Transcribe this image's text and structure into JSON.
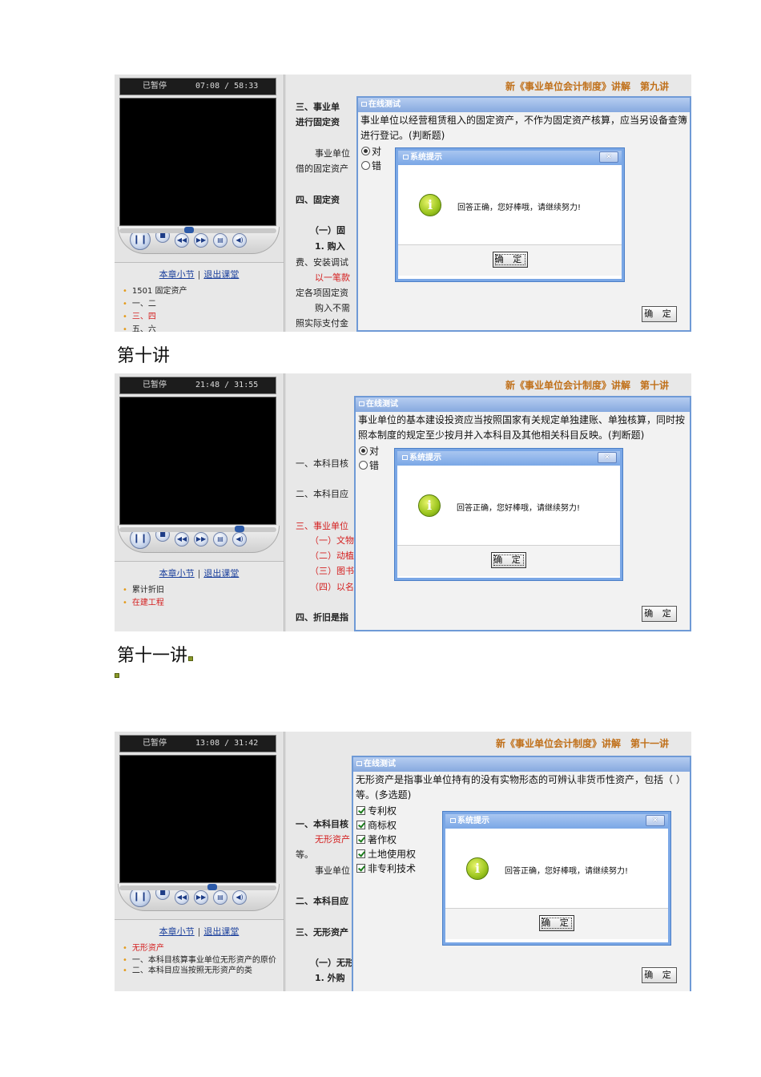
{
  "headings": {
    "lecture10": "第十讲",
    "lecture11": "第十一讲"
  },
  "common": {
    "chapter_link": "本章小节",
    "chapter_sep": "|",
    "exit_link": "退出课堂",
    "test_title": "在线测试",
    "sys_title": "系统提示",
    "sys_close": "×",
    "sys_message": "回答正确，您好棒哦，请继续努力!",
    "ok_label": "确 定",
    "info_glyph": "i",
    "option_true": "对",
    "option_false": "错"
  },
  "shot1": {
    "status": "已暂停",
    "time": "07:08 / 58:33",
    "seek_progress": 0.44,
    "lecture_title": "新《事业单位会计制度》讲解　第九讲",
    "chapter_items": [
      "1501 固定资产",
      "一、二",
      "三、四",
      "五、六"
    ],
    "text_lines": [
      "三、事业单",
      "进行固定资",
      "事业单位",
      "借的固定资产",
      "四、固定资",
      "（一）固",
      "1. 购入",
      "费、安装调试",
      "以一笔款",
      "定各项固定资",
      "购入不需",
      "照实际支付金"
    ],
    "question": "事业单位以经营租赁租入的固定资产，不作为固定资产核算，应当另设备查簿进行登记。(判断题)"
  },
  "shot2": {
    "status": "已暂停",
    "time": "21:48 / 31:55",
    "seek_progress": 0.78,
    "lecture_title": "新《事业单位会计制度》讲解　第十讲",
    "chapter_items": [
      "累计折旧",
      "在建工程"
    ],
    "text_lines": [
      "一、本科目核",
      "二、本科目应",
      "三、事业单位",
      "（一）文物",
      "（二）动植",
      "（三）图书",
      "（四）以名",
      "四、折旧是指"
    ],
    "question": "事业单位的基本建设投资应当按照国家有关规定单独建账、单独核算，同时按照本制度的规定至少按月并入本科目及其他相关科目反映。(判断题)"
  },
  "shot3": {
    "status": "已暂停",
    "time": "13:08 / 31:42",
    "seek_progress": 0.6,
    "lecture_title": "新《事业单位会计制度》讲解　第十一讲",
    "chapter_items": [
      "无形资产",
      "一、本科目核算事业单位无形资产的原价",
      "二、本科目应当按照无形资产的类"
    ],
    "text_lines": [
      "一、本科目核",
      "无形资产",
      "等。",
      "事业单位",
      "二、本科目应",
      "三、无形资产",
      "（一）无形",
      "1. 外购"
    ],
    "question": "无形资产是指事业单位持有的没有实物形态的可辨认非货币性资产，包括（ ）等。(多选题)",
    "options": [
      "专利权",
      "商标权",
      "著作权",
      "土地使用权",
      "非专利技术"
    ]
  }
}
